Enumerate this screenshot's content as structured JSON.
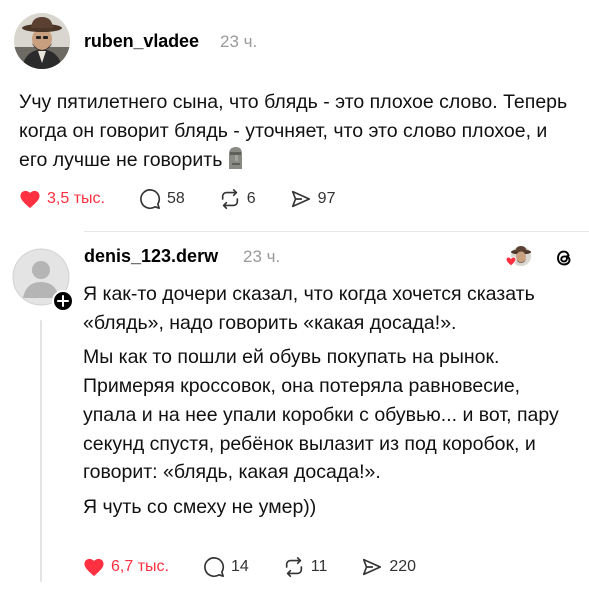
{
  "post": {
    "username": "ruben_vladee",
    "time": "23 ч.",
    "text": "Учу пятилетнего сына, что блядь - это плохое слово. Теперь когда он говорит блядь - уточняет, что это слово плохое, и его лучше не говорить",
    "emoji": "moai-icon",
    "actions": {
      "likes": "3,5 тыс.",
      "comments": "58",
      "reposts": "6",
      "shares": "97"
    }
  },
  "reply": {
    "username": "denis_123.derw",
    "time": "23 ч.",
    "paragraphs": [
      "Я как-то дочери сказал, что когда хочется сказать «блядь», надо говорить «какая досада!».",
      "Мы как то пошли ей обувь покупать на рынок. Примеряя кроссовок, она потеряла равновесие, упала и на нее упали коробки с обувью... и вот, пару секунд спустя, ребёнок вылазит из под коробок, и говорит: «блядь, какая досада!».",
      "Я чуть со смеху не умер))"
    ],
    "actions": {
      "likes": "6,7 тыс.",
      "comments": "14",
      "reposts": "11",
      "shares": "220"
    }
  },
  "colors": {
    "like": "#ff3040",
    "muted": "#9a9a9a",
    "divider": "#e6e6e6"
  }
}
